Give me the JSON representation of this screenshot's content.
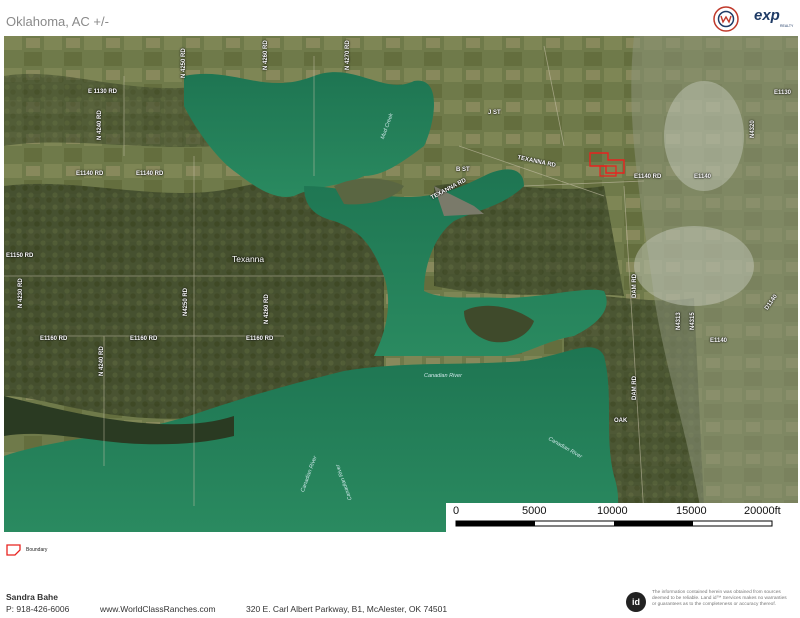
{
  "header": {
    "title": "Oklahoma,  AC +/-",
    "logo_text": "exp",
    "logo_sub": "REALTY"
  },
  "map": {
    "town": "Texanna",
    "roads": {
      "e1130": "E 1130 RD",
      "n4240": "N 4240 RD",
      "n4250": "N 4250 RD",
      "n4260": "N 4260 RD",
      "n4270": "N 4270 RD",
      "e1140a": "E1140 RD",
      "e1140b": "E1140 RD",
      "e1140c": "E1140 RD",
      "e1140d": "E1140",
      "e1140e": "E1140",
      "e1150": "E1150 RD",
      "n4230": "N 4230 RD",
      "n4250b": "N4250 RD",
      "n4260b": "N 4260 RD",
      "e1160a": "E1160 RD",
      "e1160b": "E1160 RD",
      "e1160c": "E1160 RD",
      "n4240b": "N 4240 RD",
      "texanna1": "TEXANNA RD",
      "texanna2": "TEXANNA RD",
      "bst": "B ST",
      "jst": "J ST",
      "e1130b": "E1130",
      "n4320": "N4320",
      "dam1": "DAM RD",
      "dam2": "DAM RD",
      "n4313": "N4313",
      "n4315": "N4315",
      "oak": "OAK",
      "d1140": "D1140"
    },
    "water": {
      "w1": "Mud Creek",
      "w2": "Canadian River",
      "w3": "Canadian River",
      "w4": "Canadian River",
      "w5": "Canadian River"
    },
    "scale": {
      "ticks": [
        "0",
        "5000",
        "10000",
        "15000",
        "20000ft"
      ]
    },
    "boundary_color": "#e8231f"
  },
  "legend": {
    "label": "Boundary"
  },
  "footer": {
    "name": "Sandra Bahe",
    "phone": "P: 918-426-6006",
    "website": "www.WorldClassRanches.com",
    "address": "320 E. Carl Albert Parkway, B1, McAlester, OK 74501",
    "id_logo": "id",
    "disclaimer": "The information contained herein was obtained from sources deemed to be reliable. Land id™ Services makes no warranties or guarantees as to the completeness or accuracy thereof."
  }
}
